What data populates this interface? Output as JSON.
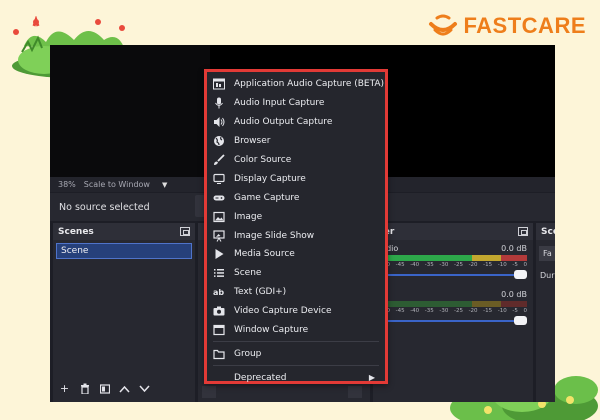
{
  "logo": {
    "text": "FASTCARE"
  },
  "preview": {
    "zoom_percent": "38%",
    "scale_mode": "Scale to Window"
  },
  "source_bar": {
    "text": "No source selected"
  },
  "scenes": {
    "title": "Scenes",
    "items": [
      "Scene"
    ]
  },
  "mixer": {
    "title": "ker",
    "channels": [
      {
        "name": "udio",
        "db": "0.0 dB",
        "ticks": [
          "-50",
          "-45",
          "-40",
          "-35",
          "-30",
          "-25",
          "-20",
          "-15",
          "-10",
          "-5",
          "0"
        ]
      },
      {
        "name": "",
        "db": "0.0 dB",
        "ticks": [
          "-50",
          "-45",
          "-40",
          "-35",
          "-30",
          "-25",
          "-20",
          "-15",
          "-10",
          "-5",
          "0"
        ]
      }
    ]
  },
  "transitions": {
    "title": "Sce",
    "field": "Fa",
    "label": "Dura"
  },
  "context_menu": {
    "items": [
      {
        "label": "Application Audio Capture (BETA)",
        "icon": "app-audio-icon"
      },
      {
        "label": "Audio Input Capture",
        "icon": "microphone-icon"
      },
      {
        "label": "Audio Output Capture",
        "icon": "speaker-icon"
      },
      {
        "label": "Browser",
        "icon": "globe-icon"
      },
      {
        "label": "Color Source",
        "icon": "brush-icon"
      },
      {
        "label": "Display Capture",
        "icon": "monitor-icon"
      },
      {
        "label": "Game Capture",
        "icon": "gamepad-icon"
      },
      {
        "label": "Image",
        "icon": "image-icon"
      },
      {
        "label": "Image Slide Show",
        "icon": "slideshow-icon"
      },
      {
        "label": "Media Source",
        "icon": "play-icon"
      },
      {
        "label": "Scene",
        "icon": "list-icon"
      },
      {
        "label": "Text (GDI+)",
        "icon": "text-icon"
      },
      {
        "label": "Video Capture Device",
        "icon": "camera-icon"
      },
      {
        "label": "Window Capture",
        "icon": "window-icon"
      }
    ],
    "group_label": "Group",
    "deprecated_label": "Deprecated"
  },
  "colors": {
    "highlight_border": "#e23a36",
    "brand_orange": "#ee7e1b",
    "scene_selected": "#26407a"
  }
}
